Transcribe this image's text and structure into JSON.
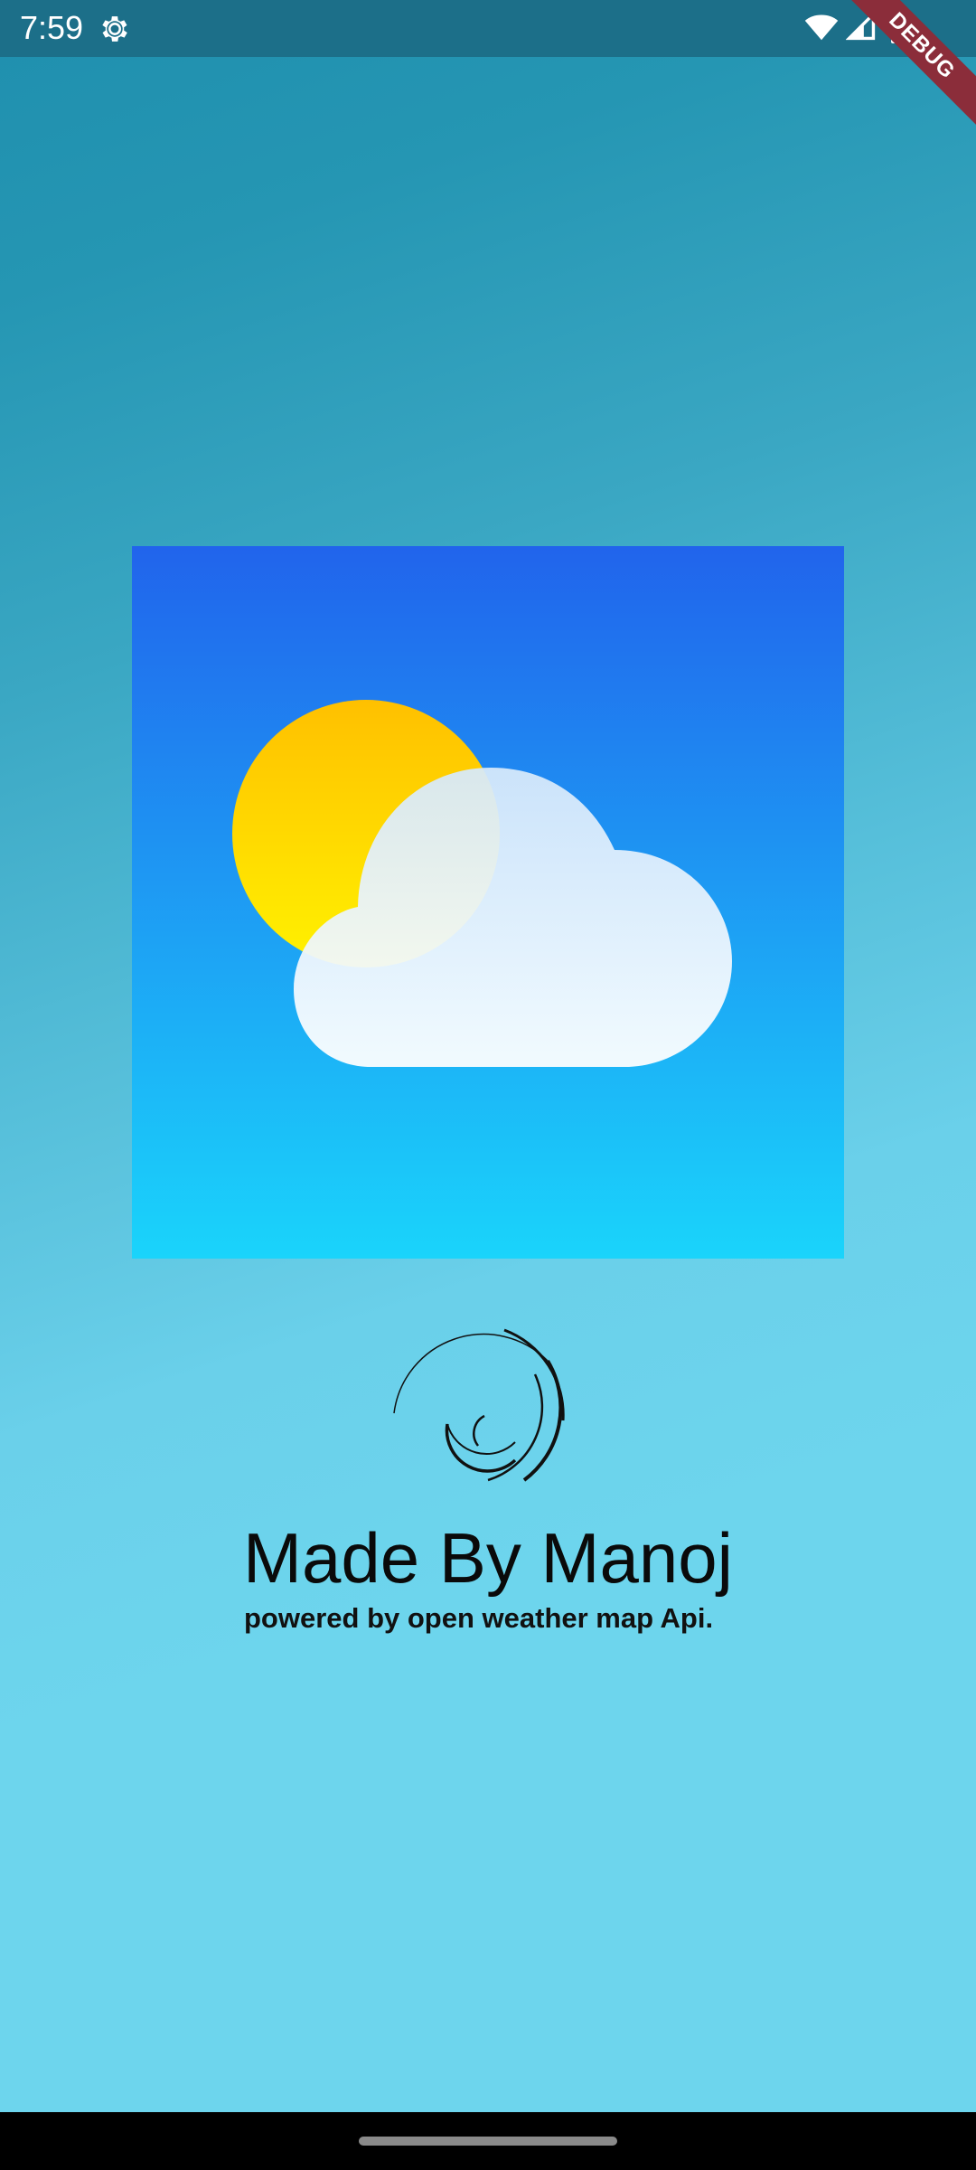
{
  "status_bar": {
    "time": "7:59",
    "icons": [
      "gear-icon",
      "wifi-icon",
      "signal-icon",
      "battery-icon"
    ]
  },
  "debug_banner": "DEBUG",
  "logo": {
    "icon": "sun-behind-cloud-icon",
    "colors": {
      "sky_top": "#2164ec",
      "sky_bottom": "#1ad4fb",
      "sun": "#ffcc00",
      "cloud": "#ffffff"
    }
  },
  "loader": {
    "icon": "loading-spinner-icon"
  },
  "splash": {
    "title": "Made By Manoj",
    "subtitle": "powered by open weather map Api."
  },
  "colors": {
    "status_bar": "#1c6f89",
    "background_top": "#1f8fae",
    "background_bottom": "#6dd5ed",
    "text": "#0a0a0a"
  }
}
